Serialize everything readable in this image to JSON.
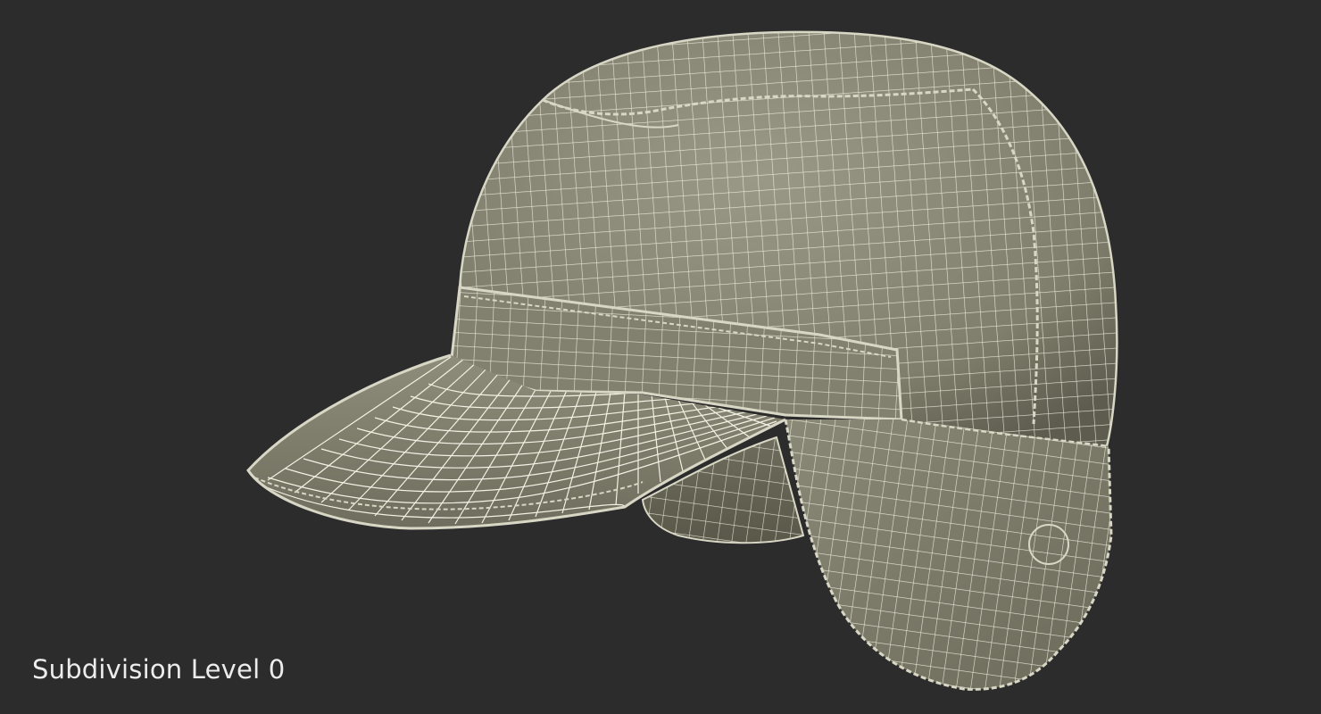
{
  "render": {
    "label": "Subdivision Level 0",
    "colors": {
      "background": "#2c2c2c",
      "surface": "#8c8a78",
      "surface_light": "#a5a392",
      "surface_dark": "#686656",
      "wire": "#f2f1e4",
      "seam": "#d8d6c4"
    }
  }
}
